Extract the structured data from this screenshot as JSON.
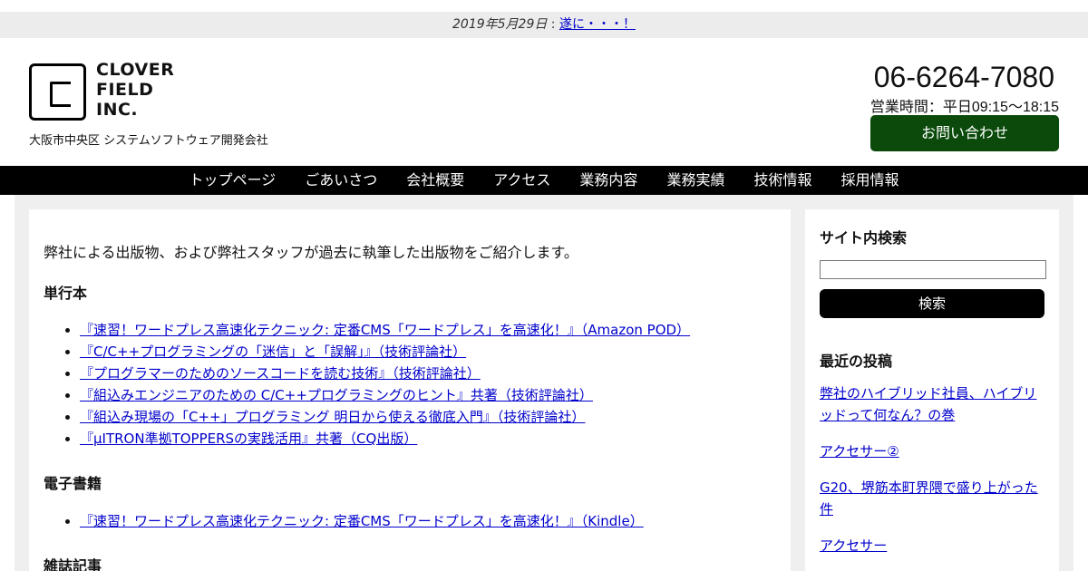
{
  "notice": {
    "date": "2019年5月29日",
    "separator": " : ",
    "link": "遂に・・・！"
  },
  "header": {
    "logo_lines": [
      "CLOVER",
      "FIELD",
      "INC."
    ],
    "tagline": "大阪市中央区 システムソフトウェア開発会社",
    "phone": "06-6264-7080",
    "hours": "営業時間：平日09:15〜18:15",
    "contact_button": "お問い合わせ"
  },
  "nav": {
    "items": [
      "トップページ",
      "ごあいさつ",
      "会社概要",
      "アクセス",
      "業務内容",
      "業務実績",
      "技術情報",
      "採用情報"
    ]
  },
  "main": {
    "intro": "弊社による出版物、および弊社スタッフが過去に執筆した出版物をご紹介します。",
    "sections": [
      {
        "heading": "単行本",
        "items": [
          "『速習！ワードプレス高速化テクニック: 定番CMS「ワードプレス」を高速化！』（Amazon POD）",
          "『C/C++プログラミングの「迷信」と「誤解」』（技術評論社）",
          "『プログラマーのためのソースコードを読む技術』（技術評論社）",
          "『組込みエンジニアのための C/C++プログラミングのヒント』共著（技術評論社）",
          "『組込み現場の「C++」プログラミング 明日から使える徹底入門』（技術評論社）",
          "『μITRON準拠TOPPERSの実践活用』共著（CQ出版）"
        ]
      },
      {
        "heading": "電子書籍",
        "items": [
          "『速習！ワードプレス高速化テクニック: 定番CMS「ワードプレス」を高速化！』（Kindle）"
        ]
      },
      {
        "heading": "雑誌記事",
        "items": []
      }
    ]
  },
  "sidebar": {
    "search_heading": "サイト内検索",
    "search_value": "",
    "search_button": "検索",
    "recent_heading": "最近の投稿",
    "recent_posts": [
      "弊社のハイブリッド社員、ハイブリッドって何なん？の巻",
      "アクセサー②",
      "G20、堺筋本町界隈で盛り上がった件",
      "アクセサー"
    ]
  },
  "colors": {
    "contact_button": "#0b4a0b",
    "nav_background": "#000000",
    "link": "#0000cc",
    "page_background": "#efefef"
  }
}
